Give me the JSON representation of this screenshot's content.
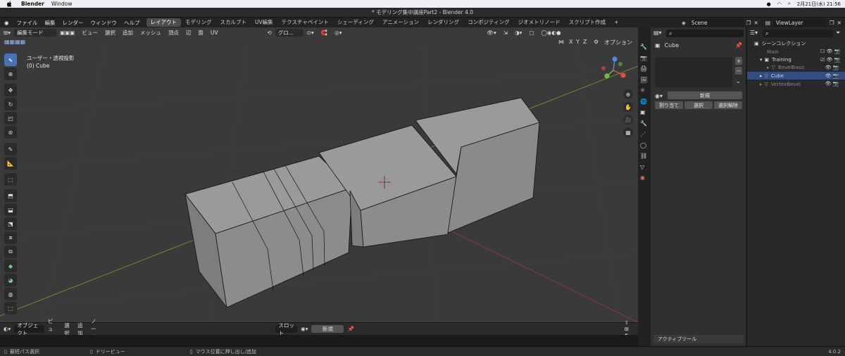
{
  "mac_menu": {
    "app": "Blender",
    "window": "Window",
    "clock": "2月21日(水) 21:56"
  },
  "title": "* モデリング集中講座Part2 - Blender 4.0",
  "top_menu": [
    "ファイル",
    "編集",
    "レンダー",
    "ウィンドウ",
    "ヘルプ"
  ],
  "workspaces": [
    "レイアウト",
    "モデリング",
    "スカルプト",
    "UV編集",
    "テクスチャペイント",
    "シェーディング",
    "アニメーション",
    "レンダリング",
    "コンポジティング",
    "ジオメトリノード",
    "スクリプト作成"
  ],
  "active_workspace": "レイアウト",
  "scene_name": "Scene",
  "view_layer": "ViewLayer",
  "viewport": {
    "mode": "編集モード",
    "menus": [
      "ビュー",
      "選択",
      "追加",
      "メッシュ",
      "頂点",
      "辺",
      "面",
      "UV"
    ],
    "transform": "グロ...",
    "overlay_title": "ユーザー・透視投影",
    "overlay_object": "(0) Cube",
    "axes": [
      "X",
      "Y",
      "Z"
    ],
    "options": "オプション"
  },
  "bottom_editor": {
    "mode": "オブジェクト",
    "menus": [
      "ビュー",
      "選択",
      "追加",
      "ノード"
    ],
    "slot": "スロット",
    "new_button": "新規"
  },
  "status": {
    "left": "最短パス選択",
    "mid": "ドリービュー",
    "right": "マウス位置に押し出し/追加",
    "version": "4.0.2"
  },
  "properties": {
    "object_name": "Cube",
    "new_button": "新規",
    "assign": "割り当て",
    "select": "選択",
    "deselect": "選択解除",
    "active_tool": "アクティブツール"
  },
  "outliner": {
    "title": "シーンコレクション",
    "rows": [
      {
        "label": "Main",
        "indent": 1,
        "kind": "collection"
      },
      {
        "label": "Training",
        "indent": 1,
        "kind": "collection"
      },
      {
        "label": "BevelBasic",
        "indent": 2,
        "kind": "mesh"
      },
      {
        "label": "Cube",
        "indent": 1,
        "kind": "mesh"
      },
      {
        "label": "VertexBevel",
        "indent": 1,
        "kind": "mesh"
      }
    ]
  },
  "colors": {
    "accent": "#4772b3",
    "selected_row": "#334d80",
    "viewport_bg": "#3a3a3a"
  }
}
